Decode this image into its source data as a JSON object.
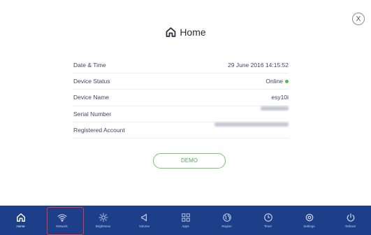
{
  "close_label": "X",
  "header": {
    "title": "Home",
    "icon": "home-icon"
  },
  "info_rows": [
    {
      "label": "Date & Time",
      "value": "29 June 2016 14:15:52"
    },
    {
      "label": "Device Status",
      "value": "Online",
      "status_color": "#56b94f"
    },
    {
      "label": "Device Name",
      "value": "esy10i"
    },
    {
      "label": "Serial Number",
      "value": "",
      "redacted": true
    },
    {
      "label": "Registered Account",
      "value": "",
      "redacted": true
    }
  ],
  "demo_button": "DEMO",
  "navbar": {
    "background": "#1d3f8a",
    "items": [
      {
        "label": "Home",
        "icon": "home-icon"
      },
      {
        "label": "Network",
        "icon": "wifi-icon"
      },
      {
        "label": "Brightness",
        "icon": "sun-icon"
      },
      {
        "label": "Volume",
        "icon": "speaker-icon"
      },
      {
        "label": "Apps",
        "icon": "grid-icon"
      },
      {
        "label": "Region",
        "icon": "globe-icon"
      },
      {
        "label": "Timer",
        "icon": "clock-icon"
      },
      {
        "label": "Settings",
        "icon": "gear-icon"
      },
      {
        "label": "Reboot",
        "icon": "power-icon"
      }
    ]
  }
}
